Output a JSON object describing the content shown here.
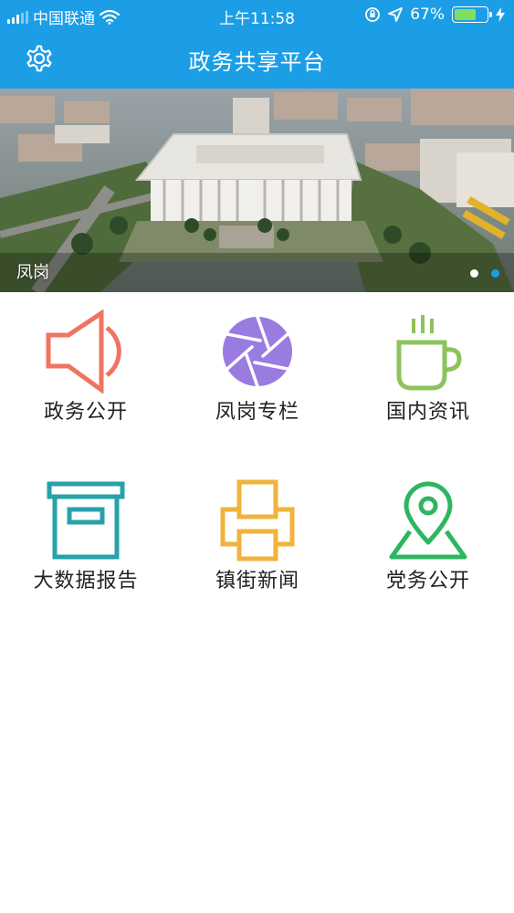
{
  "status_bar": {
    "carrier": "中国联通",
    "time": "上午11:58",
    "battery_percent": "67%",
    "battery_level": 0.67,
    "battery_color": "#7ee05e",
    "icons": [
      "signal-icon",
      "wifi-icon",
      "orientation-lock-icon",
      "location-icon",
      "battery-icon",
      "charging-icon"
    ]
  },
  "nav": {
    "title": "政务共享平台",
    "left_icon": "gear-icon",
    "background_color": "#1b9ee6"
  },
  "banner": {
    "caption": "凤岗",
    "slide_count": 2,
    "active_slide": 2,
    "active_dot_color": "#1b9ee6",
    "inactive_dot_color": "#ffffff"
  },
  "grid": {
    "items": [
      {
        "label": "政务公开",
        "icon": "speaker-icon",
        "color": "#ef7461"
      },
      {
        "label": "凤岗专栏",
        "icon": "camera-aperture-icon",
        "color": "#9a7be0"
      },
      {
        "label": "国内资讯",
        "icon": "coffee-cup-icon",
        "color": "#8dc35b"
      },
      {
        "label": "大数据报告",
        "icon": "archive-box-icon",
        "color": "#26a2a8"
      },
      {
        "label": "镇街新闻",
        "icon": "printer-icon",
        "color": "#f0b33c"
      },
      {
        "label": "党务公开",
        "icon": "map-pin-icon",
        "color": "#2fb561"
      }
    ]
  }
}
